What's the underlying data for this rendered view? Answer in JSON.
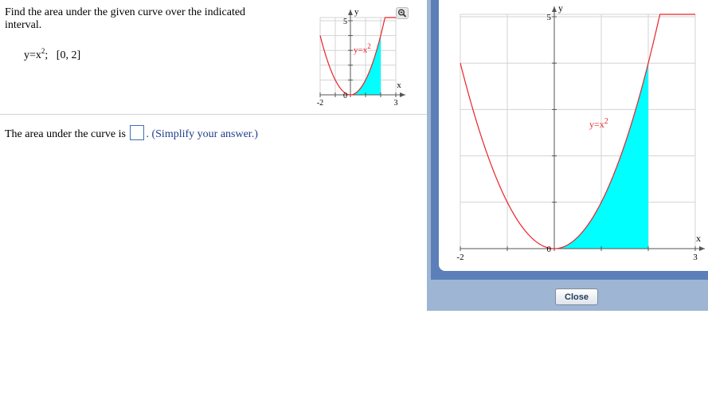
{
  "question": {
    "prompt": "Find the area under the given curve over the indicated interval.",
    "equation_base": "y=x",
    "equation_exp": "2",
    "equation_rest": ";   [0, 2]"
  },
  "answer": {
    "before": "The area under the curve is ",
    "after": ". (Simplify your answer.)"
  },
  "graph": {
    "curve_label_base": "y=x",
    "curve_label_exp": "2",
    "x_axis_label": "x",
    "y_axis_label": "y",
    "x_min_label": "-2",
    "x_max_label": "3",
    "y_max_label": "5",
    "origin_label": "0",
    "curve_color": "#e8232a",
    "fill_color": "#00ffff",
    "function": "x^2",
    "x_range": [
      -2,
      3
    ],
    "y_range": [
      0,
      5
    ],
    "shaded_interval": [
      0,
      2
    ]
  },
  "zoom_icon": "magnifier-icon",
  "close_button": "Close",
  "colors": {
    "panel_blue": "#5d7fb9",
    "panel_light": "#9eb5d3"
  }
}
